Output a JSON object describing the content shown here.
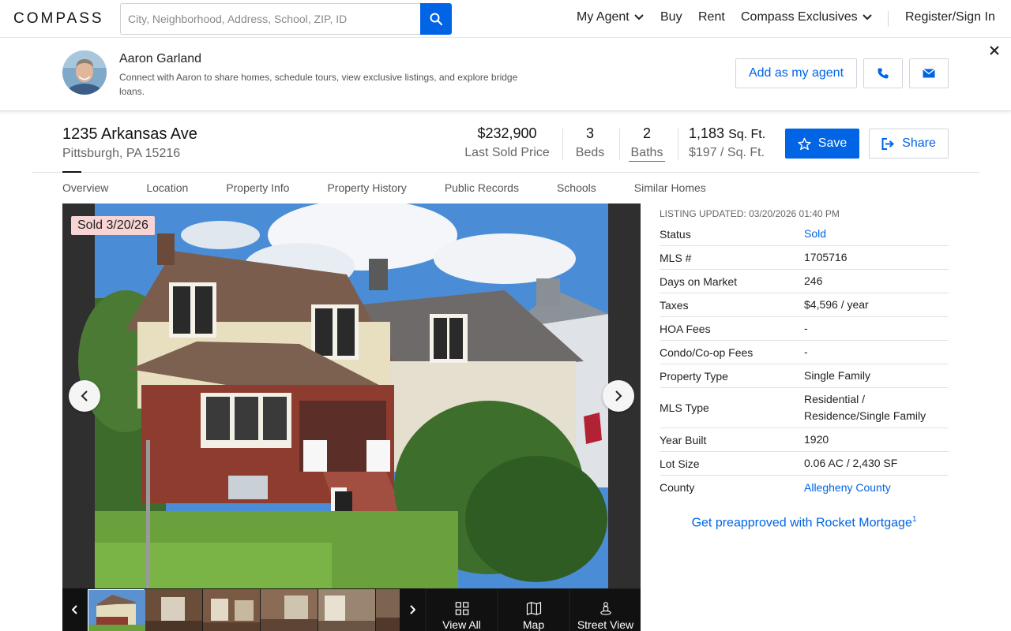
{
  "header": {
    "logo": "COMPASS",
    "search_placeholder": "City, Neighborhood, Address, School, ZIP, ID",
    "nav": {
      "my_agent": "My Agent",
      "buy": "Buy",
      "rent": "Rent",
      "exclusives": "Compass Exclusives",
      "register": "Register/Sign In"
    }
  },
  "agent": {
    "name": "Aaron Garland",
    "description": "Connect with Aaron to share homes, schedule tours, view exclusive listings, and explore bridge loans.",
    "add_button": "Add as my agent"
  },
  "property": {
    "address": "1235 Arkansas Ave",
    "city": "Pittsburgh, PA 15216",
    "price": "$232,900",
    "price_label": "Last Sold Price",
    "beds": "3",
    "beds_label": "Beds",
    "baths": "2",
    "baths_label": "Baths",
    "sqft": "1,183",
    "sqft_unit": "Sq. Ft.",
    "price_per_sqft": "$197 / Sq. Ft.",
    "save_label": "Save",
    "share_label": "Share"
  },
  "tabs": [
    "Overview",
    "Location",
    "Property Info",
    "Property History",
    "Public Records",
    "Schools",
    "Similar Homes"
  ],
  "gallery": {
    "badge": "Sold 3/20/26",
    "tools": {
      "view_all": "View All",
      "map": "Map",
      "street_view": "Street View"
    }
  },
  "listing": {
    "updated": "LISTING UPDATED: 03/20/2026 01:40 PM",
    "rows": [
      {
        "key": "Status",
        "value": "Sold"
      },
      {
        "key": "MLS #",
        "value": "1705716"
      },
      {
        "key": "Days on Market",
        "value": "246"
      },
      {
        "key": "Taxes",
        "value": "$4,596 / year"
      },
      {
        "key": "HOA Fees",
        "value": "-"
      },
      {
        "key": "Condo/Co-op Fees",
        "value": "-"
      },
      {
        "key": "Property Type",
        "value": "Single Family"
      },
      {
        "key": "MLS Type",
        "value": "Residential / Residence/Single Family"
      },
      {
        "key": "Year Built",
        "value": "1920"
      },
      {
        "key": "Lot Size",
        "value": "0.06 AC / 2,430 SF"
      },
      {
        "key": "County",
        "value": "Allegheny County"
      }
    ],
    "mortgage_link": "Get preapproved with Rocket Mortgage",
    "mortgage_sup": "1"
  },
  "colors": {
    "accent": "#0064e5",
    "sold_badge": "#f8d4d4"
  }
}
